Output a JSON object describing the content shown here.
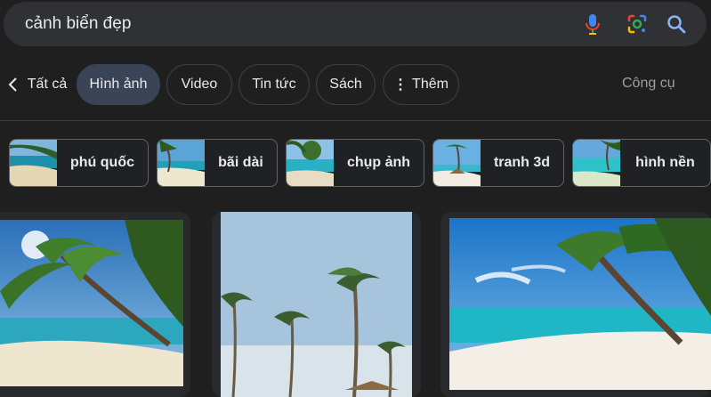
{
  "search": {
    "query": "cảnh biển đẹp",
    "icons": [
      "microphone-icon",
      "google-lens-icon",
      "search-icon"
    ]
  },
  "tabs": {
    "items": [
      {
        "label": "Tất cả",
        "active": false
      },
      {
        "label": "Hình ảnh",
        "active": true
      },
      {
        "label": "Video",
        "active": false
      },
      {
        "label": "Tin tức",
        "active": false
      },
      {
        "label": "Sách",
        "active": false
      },
      {
        "label": "Thêm",
        "active": false
      }
    ],
    "tools_label": "Công cụ"
  },
  "chips": [
    {
      "label": "phú quốc"
    },
    {
      "label": "bãi dài"
    },
    {
      "label": "chụp ảnh"
    },
    {
      "label": "tranh 3d"
    },
    {
      "label": "hình nền"
    }
  ],
  "colors": {
    "background": "#1f1f1f",
    "search_bar": "#303134",
    "active_tab": "#394457",
    "text": "#e8eaed",
    "muted_text": "#9aa0a6",
    "mic_blue": "#4285f4",
    "mic_red": "#ea4335",
    "search_icon_blue": "#8ab4f8"
  }
}
